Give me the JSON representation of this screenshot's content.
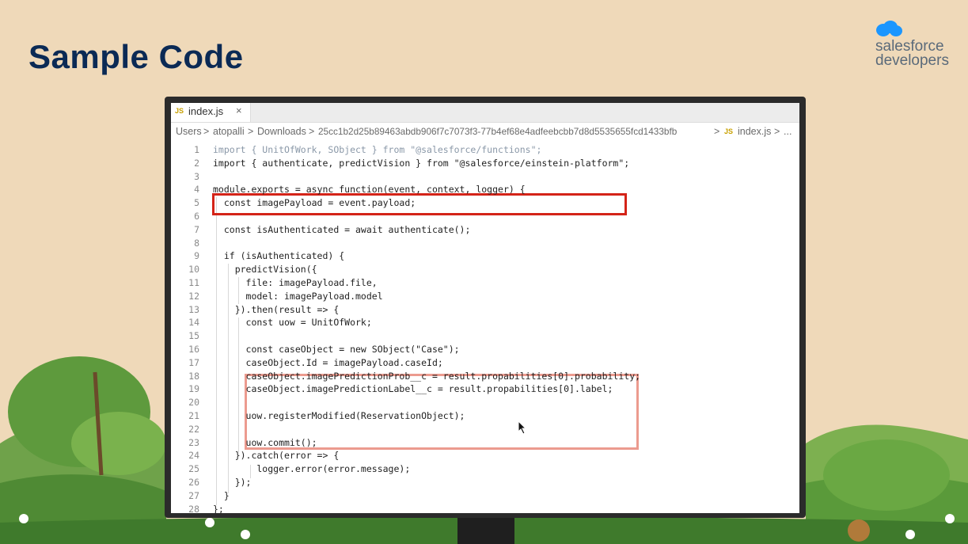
{
  "slide": {
    "title": "Sample Code",
    "logo_line1": "salesforce",
    "logo_line2": "developers"
  },
  "editor": {
    "tab": {
      "icon": "JS",
      "label": "index.js",
      "close": "×"
    },
    "breadcrumb": {
      "users": "Users",
      "sep": ">",
      "user": "atopalli",
      "downloads": "Downloads",
      "folder": "25cc1b2d25b89463abdb906f7c7073f3-77b4ef68e4adfeebcbb7d8d5535655fcd1433bfb",
      "file_icon": "JS",
      "file": "index.js",
      "more": "..."
    },
    "lines": [
      {
        "n": "1",
        "text": "import { UnitOfWork, SObject } from \"@salesforce/functions\";"
      },
      {
        "n": "2",
        "text": "import { authenticate, predictVision } from \"@salesforce/einstein-platform\";"
      },
      {
        "n": "3",
        "text": ""
      },
      {
        "n": "4",
        "text": "module.exports = async function(event, context, logger) {"
      },
      {
        "n": "5",
        "text": "  const imagePayload = event.payload;"
      },
      {
        "n": "6",
        "text": ""
      },
      {
        "n": "7",
        "text": "  const isAuthenticated = await authenticate();"
      },
      {
        "n": "8",
        "text": ""
      },
      {
        "n": "9",
        "text": "  if (isAuthenticated) {"
      },
      {
        "n": "10",
        "text": "    predictVision({"
      },
      {
        "n": "11",
        "text": "      file: imagePayload.file,"
      },
      {
        "n": "12",
        "text": "      model: imagePayload.model"
      },
      {
        "n": "13",
        "text": "    }).then(result => {"
      },
      {
        "n": "14",
        "text": "      const uow = UnitOfWork;"
      },
      {
        "n": "15",
        "text": ""
      },
      {
        "n": "16",
        "text": "      const caseObject = new SObject(\"Case\");"
      },
      {
        "n": "17",
        "text": "      caseObject.Id = imagePayload.caseId;"
      },
      {
        "n": "18",
        "text": "      caseObject.imagePredictionProb__c = result.propabilities[0].probability;"
      },
      {
        "n": "19",
        "text": "      caseObject.imagePredictionLabel__c = result.propabilities[0].label;"
      },
      {
        "n": "20",
        "text": ""
      },
      {
        "n": "21",
        "text": "      uow.registerModified(ReservationObject);"
      },
      {
        "n": "22",
        "text": ""
      },
      {
        "n": "23",
        "text": "      uow.commit();"
      },
      {
        "n": "24",
        "text": "    }).catch(error => {"
      },
      {
        "n": "25",
        "text": "        logger.error(error.message);"
      },
      {
        "n": "26",
        "text": "    });"
      },
      {
        "n": "27",
        "text": "  }"
      },
      {
        "n": "28",
        "text": "};"
      }
    ]
  },
  "colors": {
    "title": "#0b2a55",
    "highlight_red": "#d42318",
    "highlight_pink": "#ec9b8f",
    "cloud": "#1b96ff"
  }
}
